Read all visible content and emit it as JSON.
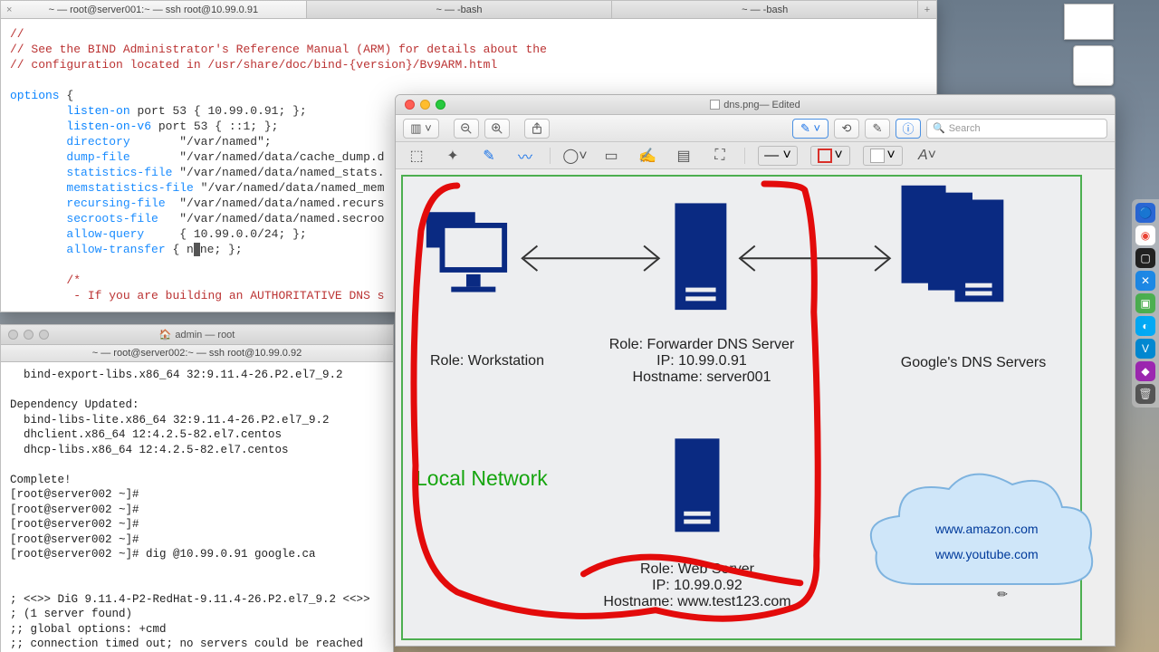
{
  "top_tabs": {
    "tab1": "~ — root@server001:~ — ssh root@10.99.0.91",
    "tab2": "~ — -bash",
    "tab3": "~ — -bash"
  },
  "config": {
    "l1": "//",
    "l2": "// See the BIND Administrator's Reference Manual (ARM) for details about the",
    "l3": "// configuration located in /usr/share/doc/bind-{version}/Bv9ARM.html",
    "options_kw": "options",
    "brace_open": " {",
    "listen_on": "listen-on",
    "listen_on_rest": " port 53 { 10.99.0.91; };",
    "listen_on_v6": "listen-on-v6",
    "listen_on_v6_rest": " port 53 { ::1; };",
    "directory": "directory",
    "directory_rest": "       \"/var/named\";",
    "dump_file": "dump-file",
    "dump_file_rest": "       \"/var/named/data/cache_dump.d",
    "stats_file": "statistics-file",
    "stats_file_rest": " \"/var/named/data/named_stats.",
    "memstats_file": "memstatistics-file",
    "memstats_file_rest": " \"/var/named/data/named_mem",
    "recursing_file": "recursing-file",
    "recursing_file_rest": "  \"/var/named/data/named.recurs",
    "secroots_file": "secroots-file",
    "secroots_file_rest": "   \"/var/named/data/named.secroo",
    "allow_query": "allow-query",
    "allow_query_rest": "     { 10.99.0.0/24; };",
    "allow_transfer": "allow-transfer",
    "allow_transfer_rest1": " { n",
    "allow_transfer_rest2": "ne; };",
    "cmt_open": "/*",
    "cmt_line": " - If you are building an AUTHORITATIVE DNS s"
  },
  "mid_window": {
    "title": "admin — root",
    "subtab": "~ — root@server002:~ — ssh root@10.99.0.92",
    "body": "  bind-export-libs.x86_64 32:9.11.4-26.P2.el7_9.2\n\nDependency Updated:\n  bind-libs-lite.x86_64 32:9.11.4-26.P2.el7_9.2\n  dhclient.x86_64 12:4.2.5-82.el7.centos\n  dhcp-libs.x86_64 12:4.2.5-82.el7.centos\n\nComplete!\n[root@server002 ~]#\n[root@server002 ~]#\n[root@server002 ~]#\n[root@server002 ~]#\n[root@server002 ~]# dig @10.99.0.91 google.ca\n\n\n; <<>> DiG 9.11.4-P2-RedHat-9.11.4-26.P2.el7_9.2 <<>>\n; (1 server found)\n;; global options: +cmd\n;; connection timed out; no servers could be reached"
  },
  "preview": {
    "title_file": "dns.png",
    "title_suffix": " — Edited",
    "search_placeholder": "Search"
  },
  "diagram": {
    "workstation_label": "Role: Workstation",
    "forwarder_l1": "Role: Forwarder DNS Server",
    "forwarder_l2": "IP: 10.99.0.91",
    "forwarder_l3": "Hostname: server001",
    "google_label": "Google's DNS Servers",
    "web_l1": "Role: Web Server",
    "web_l2": "IP: 10.99.0.92",
    "web_l3": "Hostname: www.test123.com",
    "local_net": "Local Network",
    "cloud_l1": "www.amazon.com",
    "cloud_l2": "www.youtube.com"
  }
}
